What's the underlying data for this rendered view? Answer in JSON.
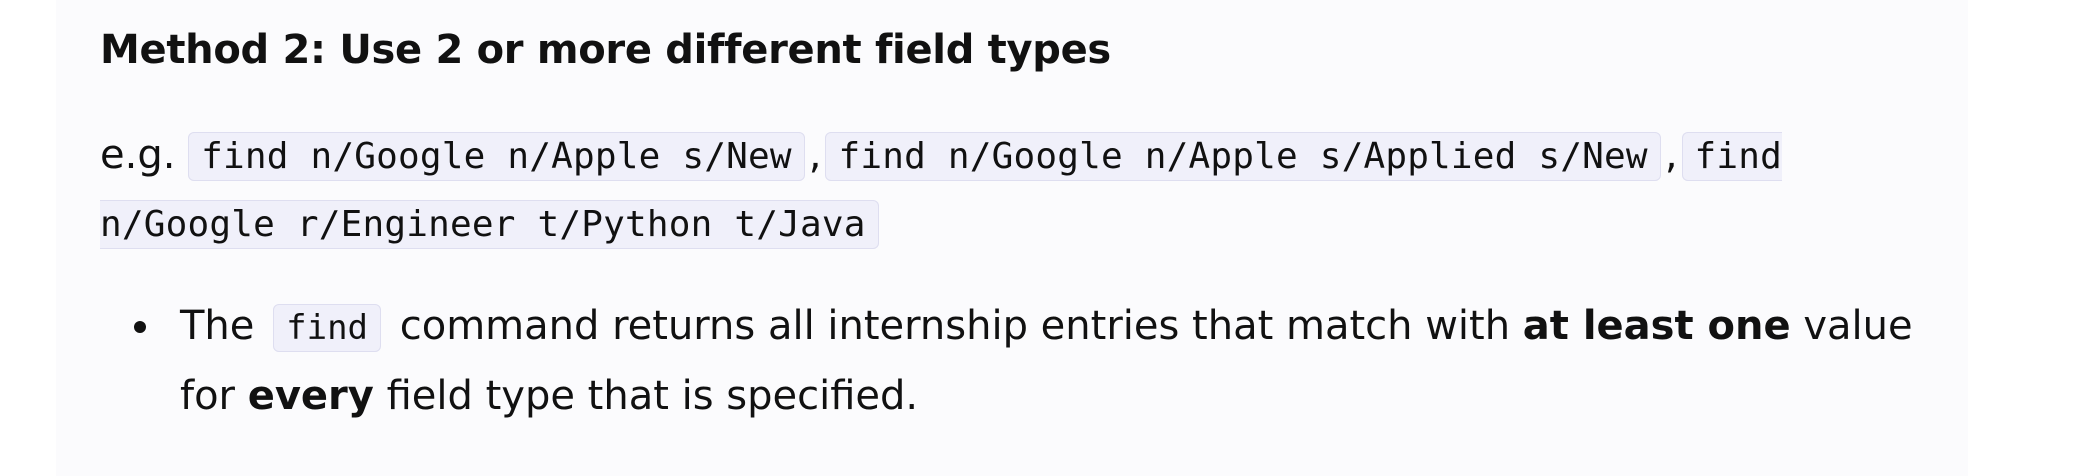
{
  "section": {
    "heading": "Method 2: Use 2 or more different field types"
  },
  "example": {
    "prefix": "e.g.",
    "separator": ",",
    "commands": [
      "find n/Google n/Apple s/New",
      "find n/Google n/Apple s/Applied s/New",
      "find n/Google r/Engineer t/Python t/Java"
    ]
  },
  "bullet": {
    "text_1": "The",
    "code": "find",
    "text_2": "command returns all internship entries that match with",
    "bold_1": "at least one",
    "text_3": "value for",
    "bold_2": "every",
    "text_4": "field type that is specified."
  }
}
